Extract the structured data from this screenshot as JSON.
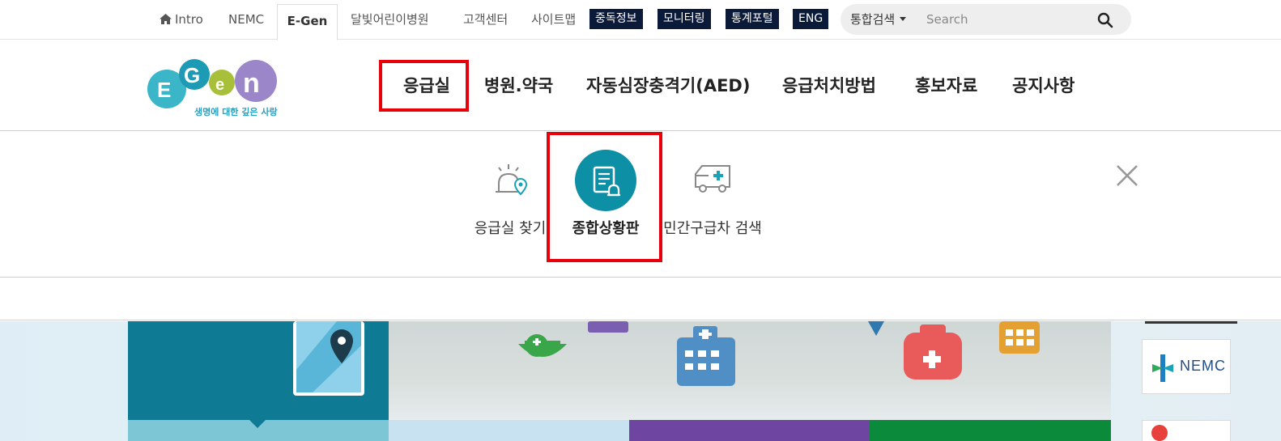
{
  "topbar": {
    "links": [
      "Intro",
      "NEMC",
      "E-Gen",
      "달빛어린이병원",
      "고객센터",
      "사이트맵"
    ],
    "buttons": [
      "중독정보",
      "모니터링",
      "통계포털",
      "ENG"
    ],
    "search": {
      "scope": "통합검색",
      "placeholder": "Search"
    }
  },
  "header": {
    "logo_tagline": "생명에 대한 깊은 사랑",
    "logo_text": "E-Gen",
    "nav": [
      "응급실",
      "병원.약국",
      "자동심장충격기(AED)",
      "응급처치방법",
      "홍보자료",
      "공지사항"
    ]
  },
  "submenu": {
    "items": [
      "응급실 찾기",
      "종합상황판",
      "민간구급차 검색"
    ]
  },
  "hero": {
    "partner_logo": "NEMC"
  },
  "colors": {
    "highlight": "#e8000b",
    "dark_button": "#0c1a3a",
    "accent_teal": "#0d8fa6"
  }
}
